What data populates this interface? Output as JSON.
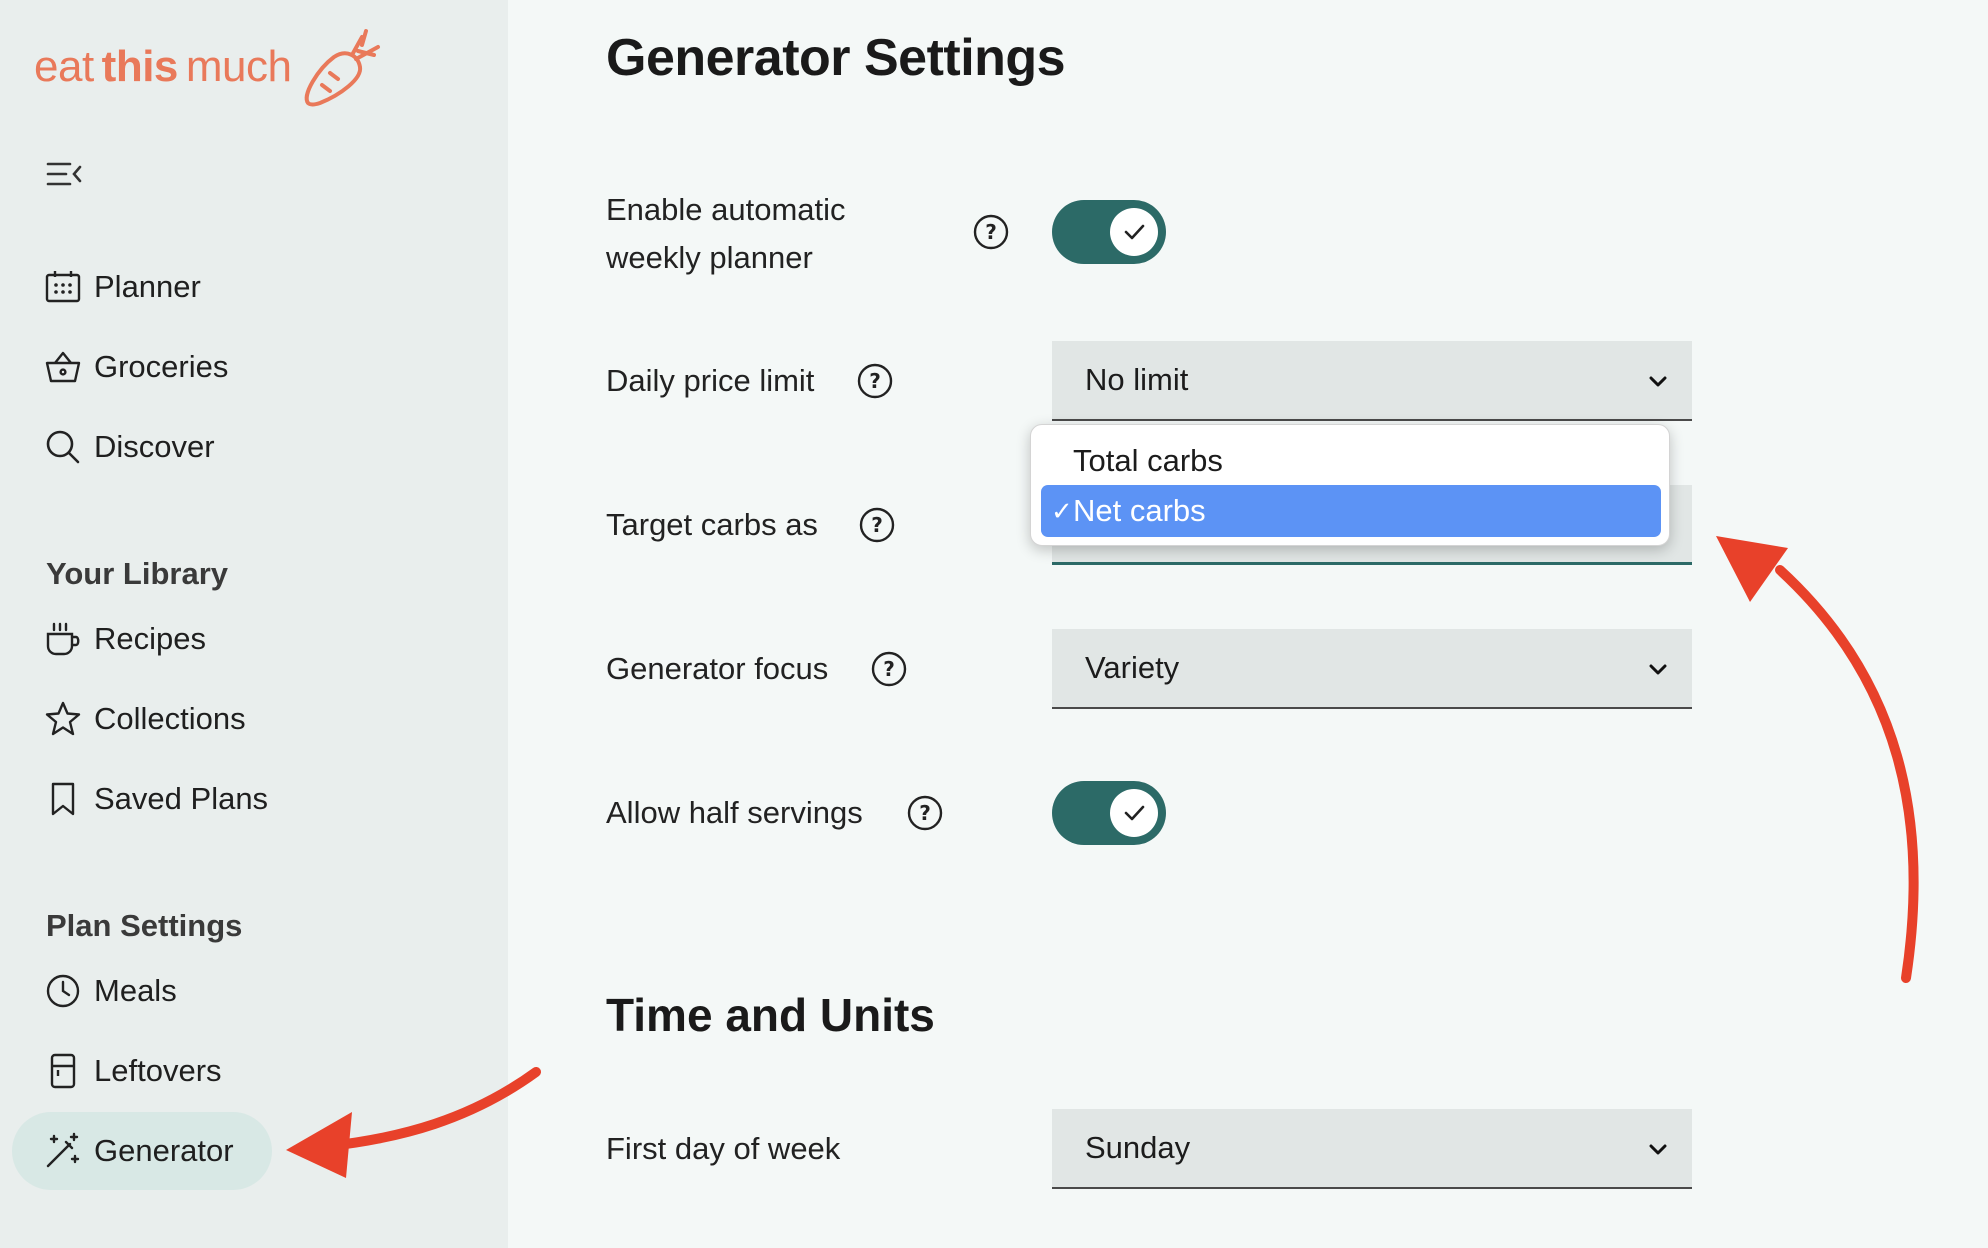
{
  "app": {
    "logo_word1": "eat",
    "logo_word2": "this",
    "logo_word3": "much"
  },
  "sidebar": {
    "collapse_icon": "menu-collapse-icon",
    "items": [
      {
        "label": "Planner",
        "icon": "calendar-icon"
      },
      {
        "label": "Groceries",
        "icon": "basket-icon"
      },
      {
        "label": "Discover",
        "icon": "search-icon"
      }
    ],
    "library_heading": "Your Library",
    "library_items": [
      {
        "label": "Recipes",
        "icon": "cup-icon"
      },
      {
        "label": "Collections",
        "icon": "star-icon"
      },
      {
        "label": "Saved Plans",
        "icon": "bookmark-icon"
      }
    ],
    "plan_settings_heading": "Plan Settings",
    "plan_items": [
      {
        "label": "Meals",
        "icon": "clock-icon"
      },
      {
        "label": "Leftovers",
        "icon": "container-icon"
      },
      {
        "label": "Generator",
        "icon": "magic-wand-icon",
        "active": true
      }
    ]
  },
  "main": {
    "title": "Generator Settings",
    "weekly_planner_label_line1": "Enable automatic",
    "weekly_planner_label_line2": "weekly planner",
    "weekly_planner_enabled": true,
    "price_limit_label": "Daily price limit",
    "price_limit_value": "No limit",
    "carbs_label": "Target carbs as",
    "carbs_options": [
      "Total carbs",
      "Net carbs"
    ],
    "carbs_selected": "Net carbs",
    "check_mark": "✓",
    "focus_label": "Generator focus",
    "focus_value": "Variety",
    "half_servings_label": "Allow half servings",
    "half_servings_enabled": true,
    "time_units_title": "Time and Units",
    "first_day_label": "First day of week",
    "first_day_value": "Sunday"
  },
  "colors": {
    "brand": "#e9795a",
    "toggle_on": "#2c6a67",
    "sidebar_active": "#d8e8e5",
    "option_selected": "#5c93f5",
    "annotation_arrow": "#e8412a"
  }
}
